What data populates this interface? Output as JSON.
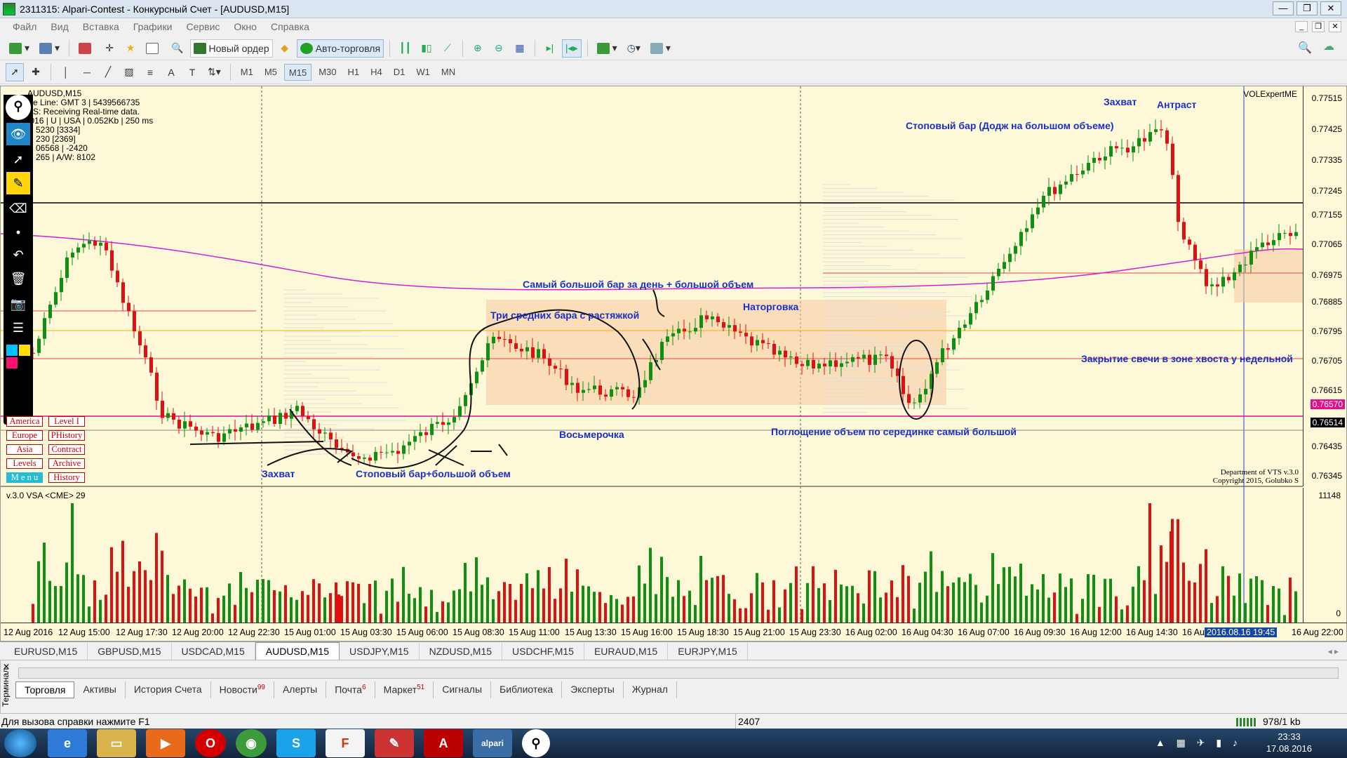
{
  "window": {
    "title": "2311315: Alpari-Contest - Конкурсный Счет - [AUDUSD,M15]"
  },
  "menu": [
    "Файл",
    "Вид",
    "Вставка",
    "Графики",
    "Сервис",
    "Окно",
    "Справка"
  ],
  "toolbar1": {
    "new_order": "Новый ордер",
    "auto_trading": "Авто-торговля"
  },
  "timeframes": [
    "M1",
    "M5",
    "M15",
    "M30",
    "H1",
    "H4",
    "D1",
    "W1",
    "MN"
  ],
  "active_timeframe": "M15",
  "info": {
    "line1": "AUDUSD,M15",
    "line2": "e Line: GMT 3 | 5439566735",
    "line3": "S:  Receiving Real-time data.",
    "line4": "15/9/2016 | U | USA | 0.052Kb | 250 ms",
    "line5": "5230  [3334]",
    "line6": "230  [2369]",
    "line7": "06568 | -2420",
    "line8": "265 | A/W: 8102"
  },
  "session_buttons": [
    [
      "America",
      "Level I"
    ],
    [
      "Europe",
      "PHistory"
    ],
    [
      "Asia",
      "Contract"
    ],
    [
      "Levels",
      "Archive"
    ],
    [
      "M e n u",
      "History"
    ]
  ],
  "prices": [
    "0.77515",
    "0.77425",
    "0.77335",
    "0.77245",
    "0.77155",
    "0.77065",
    "0.76975",
    "0.76885",
    "0.76795",
    "0.76705",
    "0.76615",
    "0.76570",
    "0.76514",
    "0.76435",
    "0.76345"
  ],
  "volume_axis": {
    "max": "11148",
    "min": "0"
  },
  "vsa_label": "v.3.0 VSA <CME> 29",
  "volexpert": "VOLExpertME",
  "vts": {
    "line1": "Department of VTS  v.3.0",
    "line2": "Copyright 2015, Golubko S"
  },
  "annotations": [
    {
      "text": "Захват",
      "key": "a1"
    },
    {
      "text": "Антраст",
      "key": "a2"
    },
    {
      "text": "Стоповый бар (Додж на большом объеме)",
      "key": "a3"
    },
    {
      "text": "Самый большой бар за день + большой объем",
      "key": "a4"
    },
    {
      "text": "Три средних бара с растяжкой",
      "key": "a5"
    },
    {
      "text": "Наторговка",
      "key": "a6"
    },
    {
      "text": "Закрытие свечи в зоне хвоста у недельной",
      "key": "a7"
    },
    {
      "text": "Восьмерочка",
      "key": "a8"
    },
    {
      "text": "Поглощение объем по серединке самый большой",
      "key": "a9"
    },
    {
      "text": "Захват",
      "key": "a10"
    },
    {
      "text": "Стоповый бар+большой объем",
      "key": "a11"
    }
  ],
  "time_labels": [
    "12 Aug 2016",
    "12 Aug 15:00",
    "12 Aug 17:30",
    "12 Aug 20:00",
    "12 Aug 22:30",
    "15 Aug 01:00",
    "15 Aug 03:30",
    "15 Aug 06:00",
    "15 Aug 08:30",
    "15 Aug 11:00",
    "15 Aug 13:30",
    "15 Aug 16:00",
    "15 Aug 18:30",
    "15 Aug 21:00",
    "15 Aug 23:30",
    "16 Aug 02:00",
    "16 Aug 04:30",
    "16 Aug 07:00",
    "16 Aug 09:30",
    "16 Aug 12:00",
    "16 Aug 14:30",
    "16 Au",
    "2016.08.16 19:45",
    "16 Aug 22:00"
  ],
  "symbol_tabs": [
    "EURUSD,M15",
    "GBPUSD,M15",
    "USDCAD,M15",
    "AUDUSD,M15",
    "USDJPY,M15",
    "NZDUSD,M15",
    "USDCHF,M15",
    "EURAUD,M15",
    "EURJPY,M15"
  ],
  "active_symbol": "AUDUSD,M15",
  "terminal": {
    "side_label": "Терминал",
    "tabs": [
      {
        "label": "Торговля",
        "badge": ""
      },
      {
        "label": "Активы",
        "badge": ""
      },
      {
        "label": "История Счета",
        "badge": ""
      },
      {
        "label": "Новости",
        "badge": "99"
      },
      {
        "label": "Алерты",
        "badge": ""
      },
      {
        "label": "Почта",
        "badge": "6"
      },
      {
        "label": "Маркет",
        "badge": "51"
      },
      {
        "label": "Сигналы",
        "badge": ""
      },
      {
        "label": "Библиотека",
        "badge": ""
      },
      {
        "label": "Эксперты",
        "badge": ""
      },
      {
        "label": "Журнал",
        "badge": ""
      }
    ]
  },
  "status": {
    "help": "Для вызова справки нажмите F1",
    "count": "2407",
    "traffic": "978/1 kb"
  },
  "taskbar": {
    "time": "23:33",
    "date": "17.08.2016",
    "alpari": "alpari"
  },
  "colors": {
    "chart_bg": "#fdf9d8",
    "bull": "#109010",
    "bear": "#e01010",
    "ma": "#d020d0",
    "annotation": "#1c2fc4",
    "zone": "#f8c9a0"
  }
}
